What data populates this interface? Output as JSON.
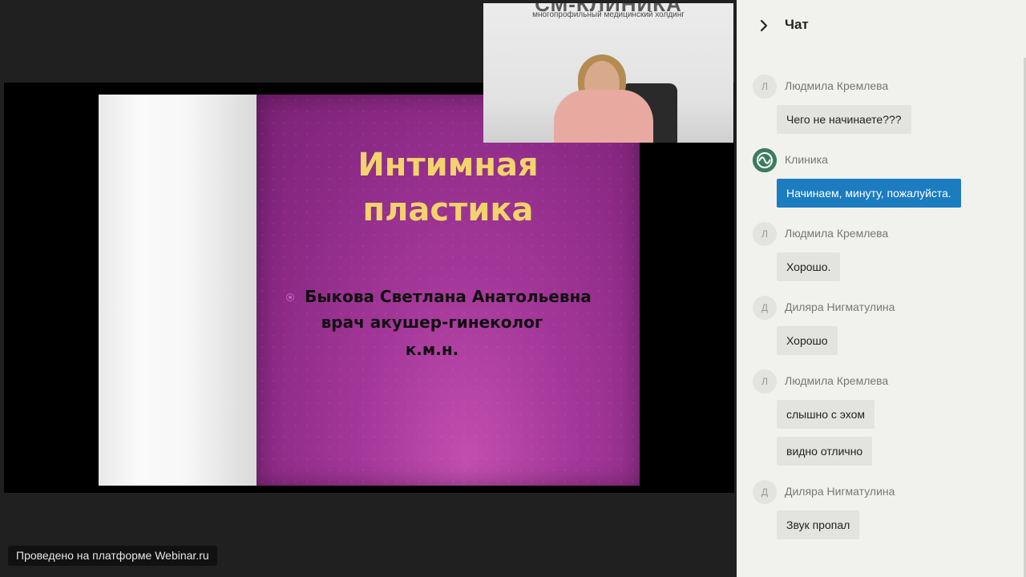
{
  "slide": {
    "title_line1": "Интимная",
    "title_line2": "пластика",
    "presenter_name": "Быкова Светлана Анатольевна",
    "presenter_role": "врач акушер-гинеколог",
    "presenter_degree": "к.м.н."
  },
  "camera": {
    "logo_text": "СМ-КЛИНИКА",
    "logo_subtitle": "многопрофильный медицинский холдинг"
  },
  "platform_badge": "Проведено на платформе Webinar.ru",
  "chat": {
    "title": "Чат",
    "collapse_icon": "chevron-right-icon",
    "messages": [
      {
        "initial": "Л",
        "author": "Людмила Кремлева",
        "texts": [
          "Чего не начинаете???"
        ]
      },
      {
        "initial": "",
        "author": "Клиника",
        "texts": [
          "Начинаем, минуту, пожалуйста."
        ],
        "highlight_color": "#1b7cc0"
      },
      {
        "initial": "Л",
        "author": "Людмила Кремлева",
        "texts": [
          "Хорошо."
        ]
      },
      {
        "initial": "Д",
        "author": "Диляра Нигматулина",
        "texts": [
          "Хорошо"
        ]
      },
      {
        "initial": "Л",
        "author": "Людмила Кремлева",
        "texts": [
          "слышно с эхом",
          "видно отлично"
        ]
      },
      {
        "initial": "Д",
        "author": "Диляра Нигматулина",
        "texts": [
          "Звук пропал"
        ]
      }
    ]
  }
}
